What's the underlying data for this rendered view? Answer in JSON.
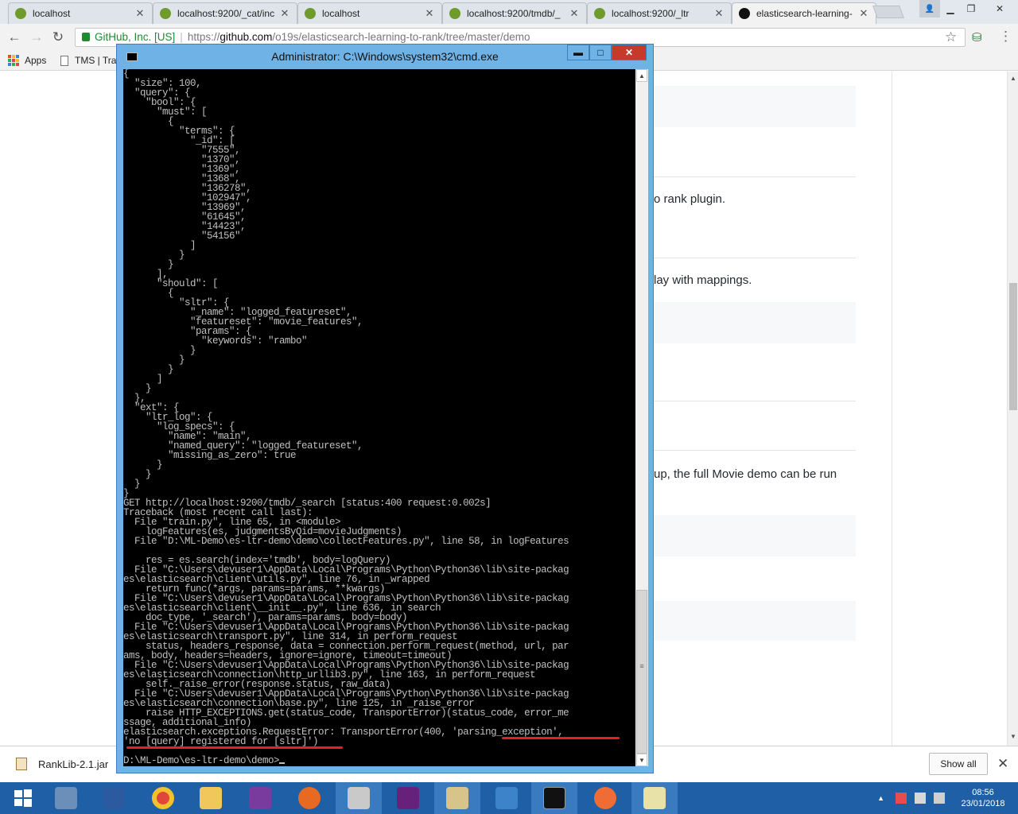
{
  "browser": {
    "tabs": [
      {
        "title": "localhost",
        "favicon_color": "#6f9a2c"
      },
      {
        "title": "localhost:9200/_cat/inc",
        "favicon_color": "#6f9a2c"
      },
      {
        "title": "localhost",
        "favicon_color": "#6f9a2c"
      },
      {
        "title": "localhost:9200/tmdb/_",
        "favicon_color": "#6f9a2c"
      },
      {
        "title": "localhost:9200/_ltr",
        "favicon_color": "#6f9a2c"
      },
      {
        "title": "elasticsearch-learning-",
        "favicon_color": "#111111"
      }
    ],
    "address": {
      "secure_label": "GitHub, Inc. [US]",
      "scheme": "https://",
      "host": "github.com",
      "path": "/o19s/elasticsearch-learning-to-rank/tree/master/demo"
    },
    "bookmarks": [
      "Apps",
      "TMS | Tra"
    ],
    "page_fragments": [
      "o rank plugin.",
      "lay with mappings.",
      "up, the full Movie demo can be run"
    ]
  },
  "downloads": {
    "file": "RankLib-2.1.jar",
    "show_all": "Show all"
  },
  "cmd": {
    "title": "Administrator: C:\\Windows\\system32\\cmd.exe",
    "minimize": "▬",
    "maximize": "□",
    "close": "✕",
    "output": "{\n  \"size\": 100,\n  \"query\": {\n    \"bool\": {\n      \"must\": [\n        {\n          \"terms\": {\n            \"_id\": [\n              \"7555\",\n              \"1370\",\n              \"1369\",\n              \"1368\",\n              \"136278\",\n              \"102947\",\n              \"13969\",\n              \"61645\",\n              \"14423\",\n              \"54156\"\n            ]\n          }\n        }\n      ],\n      \"should\": [\n        {\n          \"sltr\": {\n            \"_name\": \"logged_featureset\",\n            \"featureset\": \"movie_features\",\n            \"params\": {\n              \"keywords\": \"rambo\"\n            }\n          }\n        }\n      ]\n    }\n  },\n  \"ext\": {\n    \"ltr_log\": {\n      \"log_specs\": {\n        \"name\": \"main\",\n        \"named_query\": \"logged_featureset\",\n        \"missing_as_zero\": true\n      }\n    }\n  }\n}\nGET http://localhost:9200/tmdb/_search [status:400 request:0.002s]\nTraceback (most recent call last):\n  File \"train.py\", line 65, in <module>\n    logFeatures(es, judgmentsByQid=movieJudgments)\n  File \"D:\\ML-Demo\\es-ltr-demo\\demo\\collectFeatures.py\", line 58, in logFeatures\n\n    res = es.search(index='tmdb', body=logQuery)\n  File \"C:\\Users\\devuser1\\AppData\\Local\\Programs\\Python\\Python36\\lib\\site-packag\nes\\elasticsearch\\client\\utils.py\", line 76, in _wrapped\n    return func(*args, params=params, **kwargs)\n  File \"C:\\Users\\devuser1\\AppData\\Local\\Programs\\Python\\Python36\\lib\\site-packag\nes\\elasticsearch\\client\\__init__.py\", line 636, in search\n    doc_type, '_search'), params=params, body=body)\n  File \"C:\\Users\\devuser1\\AppData\\Local\\Programs\\Python\\Python36\\lib\\site-packag\nes\\elasticsearch\\transport.py\", line 314, in perform_request\n    status, headers_response, data = connection.perform_request(method, url, par\nams, body, headers=headers, ignore=ignore, timeout=timeout)\n  File \"C:\\Users\\devuser1\\AppData\\Local\\Programs\\Python\\Python36\\lib\\site-packag\nes\\elasticsearch\\connection\\http_urllib3.py\", line 163, in perform_request\n    self._raise_error(response.status, raw_data)\n  File \"C:\\Users\\devuser1\\AppData\\Local\\Programs\\Python\\Python36\\lib\\site-packag\nes\\elasticsearch\\connection\\base.py\", line 125, in _raise_error\n    raise HTTP_EXCEPTIONS.get(status_code, TransportError)(status_code, error_me\nssage, additional_info)\nelasticsearch.exceptions.RequestError: TransportError(400, 'parsing_exception',\n'no [query] registered for [sltr]')\n\nD:\\ML-Demo\\es-ltr-demo\\demo>"
  },
  "taskbar": {
    "apps": [
      "start",
      "server-manager",
      "powershell",
      "chrome",
      "file-explorer",
      "onenote",
      "firefox",
      "ssms-tools",
      "visual-studio",
      "snipping-tool",
      "remote-desktop",
      "command-prompt",
      "postman",
      "notepad-chart"
    ],
    "time": "08:56",
    "date": "23/01/2018"
  },
  "colors": {
    "console_bg": "#000000",
    "console_text": "#c0c0c0",
    "cmd_frame": "#6fb3e6",
    "annotation_red": "#e52222",
    "taskbar": "#1f5fa6",
    "secure_green": "#1e8a32"
  }
}
